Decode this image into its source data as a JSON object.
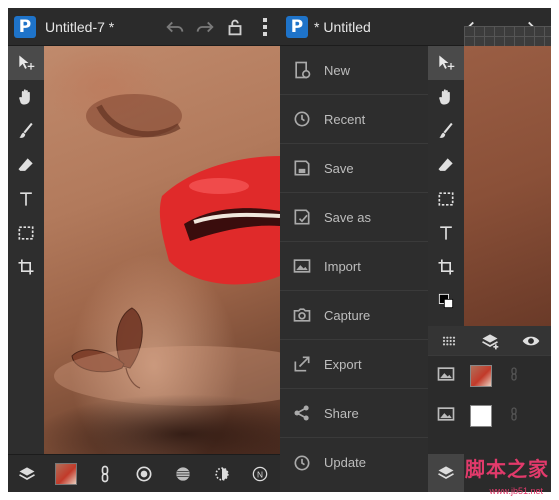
{
  "left": {
    "title": "Untitled-7 *",
    "tools": [
      {
        "name": "move-tool",
        "icon": "cursor-arrows-icon",
        "active": true
      },
      {
        "name": "pan-tool",
        "icon": "hand-icon"
      },
      {
        "name": "brush-tool",
        "icon": "brush-icon"
      },
      {
        "name": "eraser-tool",
        "icon": "eraser-icon"
      },
      {
        "name": "text-tool",
        "icon": "text-t-icon"
      },
      {
        "name": "select-tool",
        "icon": "dashed-rectangle-icon"
      },
      {
        "name": "crop-tool",
        "icon": "crop-icon"
      }
    ],
    "bottom_tools": [
      "layers-icon",
      "image-thumbnail",
      "link-icon",
      "radial-icon",
      "sphere-icon",
      "exposure-icon",
      "n-badge-icon"
    ]
  },
  "right": {
    "title": "* Untitled",
    "menu": [
      {
        "label": "New",
        "icon": "new-document-icon"
      },
      {
        "label": "Recent",
        "icon": "clock-icon"
      },
      {
        "label": "Save",
        "icon": "save-icon"
      },
      {
        "label": "Save as",
        "icon": "save-as-icon"
      },
      {
        "label": "Import",
        "icon": "image-icon"
      },
      {
        "label": "Capture",
        "icon": "camera-icon"
      },
      {
        "label": "Export",
        "icon": "export-icon"
      },
      {
        "label": "Share",
        "icon": "share-icon"
      },
      {
        "label": "Update",
        "icon": "update-clock-icon"
      }
    ]
  },
  "colors": {
    "brand": "#1e73c9",
    "panel": "#2a2a2a",
    "lips": "#e02a2a"
  },
  "watermark": {
    "text": "脚本之家",
    "sub": "www.jb51.net"
  }
}
